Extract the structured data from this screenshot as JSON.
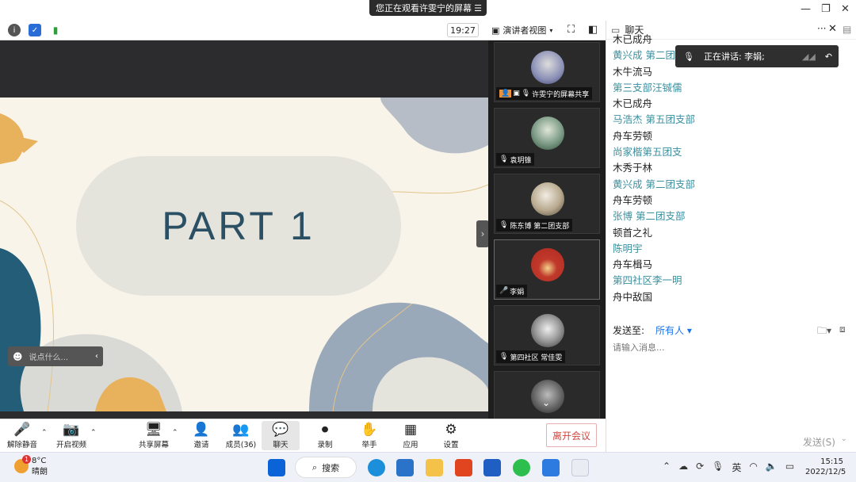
{
  "banner": {
    "text": "您正在观看许雯宁的屏幕",
    "menu_icon": "menu-icon"
  },
  "window_controls": {
    "minimize": "—",
    "restore": "❐",
    "close": "✕"
  },
  "toolbar": {
    "time": "19:27",
    "view_label": "演讲者视图"
  },
  "slide": {
    "title": "PART 1"
  },
  "overlay": {
    "chat_placeholder": "说点什么..."
  },
  "gallery": [
    {
      "name": "许雯宁的屏幕共享",
      "color": "#8a8fb5"
    },
    {
      "name": "袁玥锥",
      "color": "#7c9b86"
    },
    {
      "name": "陈东博 第二团支部",
      "color": "#b8a98f"
    },
    {
      "name": "李娟",
      "color": "#c0392b"
    },
    {
      "name": "第四社区 常佳雯",
      "color": "#bbb"
    },
    {
      "name": "",
      "color": "#888"
    }
  ],
  "chat": {
    "title": "聊天",
    "speaking_label": "正在讲话: 李娟;",
    "messages": [
      {
        "type": "text",
        "text": "木已成舟"
      },
      {
        "type": "sender",
        "text": "黄兴成 第二团支部"
      },
      {
        "type": "text",
        "text": "木牛流马"
      },
      {
        "type": "sender",
        "text": "第三支部汪铖儒"
      },
      {
        "type": "text",
        "text": "木已成舟"
      },
      {
        "type": "sender",
        "text": "马浩杰 第五团支部"
      },
      {
        "type": "text",
        "text": "舟车劳顿"
      },
      {
        "type": "sender",
        "text": "尚家楷第五团支"
      },
      {
        "type": "text",
        "text": "木秀于林"
      },
      {
        "type": "sender",
        "text": "黄兴成 第二团支部"
      },
      {
        "type": "text",
        "text": "舟车劳顿"
      },
      {
        "type": "sender",
        "text": "张博 第二团支部"
      },
      {
        "type": "text",
        "text": "顿首之礼"
      },
      {
        "type": "sender",
        "text": "陈明宇"
      },
      {
        "type": "text",
        "text": "舟车楫马"
      },
      {
        "type": "sender",
        "text": "第四社区李一明"
      },
      {
        "type": "text",
        "text": "舟中敌国"
      }
    ],
    "send_to_label": "发送至:",
    "send_to_value": "所有人 ▾",
    "input_placeholder": "请输入消息...",
    "send_button": "发送(S)"
  },
  "controls": [
    {
      "label": "解除静音",
      "icon": "🎤"
    },
    {
      "label": "开启视频",
      "icon": "📷"
    },
    {
      "label": "共享屏幕",
      "icon": "🖥"
    },
    {
      "label": "邀请",
      "icon": "👤"
    },
    {
      "label": "成员(36)",
      "icon": "👥"
    },
    {
      "label": "聊天",
      "icon": "💬"
    },
    {
      "label": "录制",
      "icon": "⏺"
    },
    {
      "label": "举手",
      "icon": "✋"
    },
    {
      "label": "应用",
      "icon": "▦"
    },
    {
      "label": "设置",
      "icon": "⚙"
    }
  ],
  "leave_button": "离开会议",
  "taskbar": {
    "weather_temp": "8°C",
    "weather_text": "晴朗",
    "weather_badge": "1",
    "search_label": "搜索",
    "ime": "英",
    "time": "15:15",
    "date": "2022/12/5"
  }
}
